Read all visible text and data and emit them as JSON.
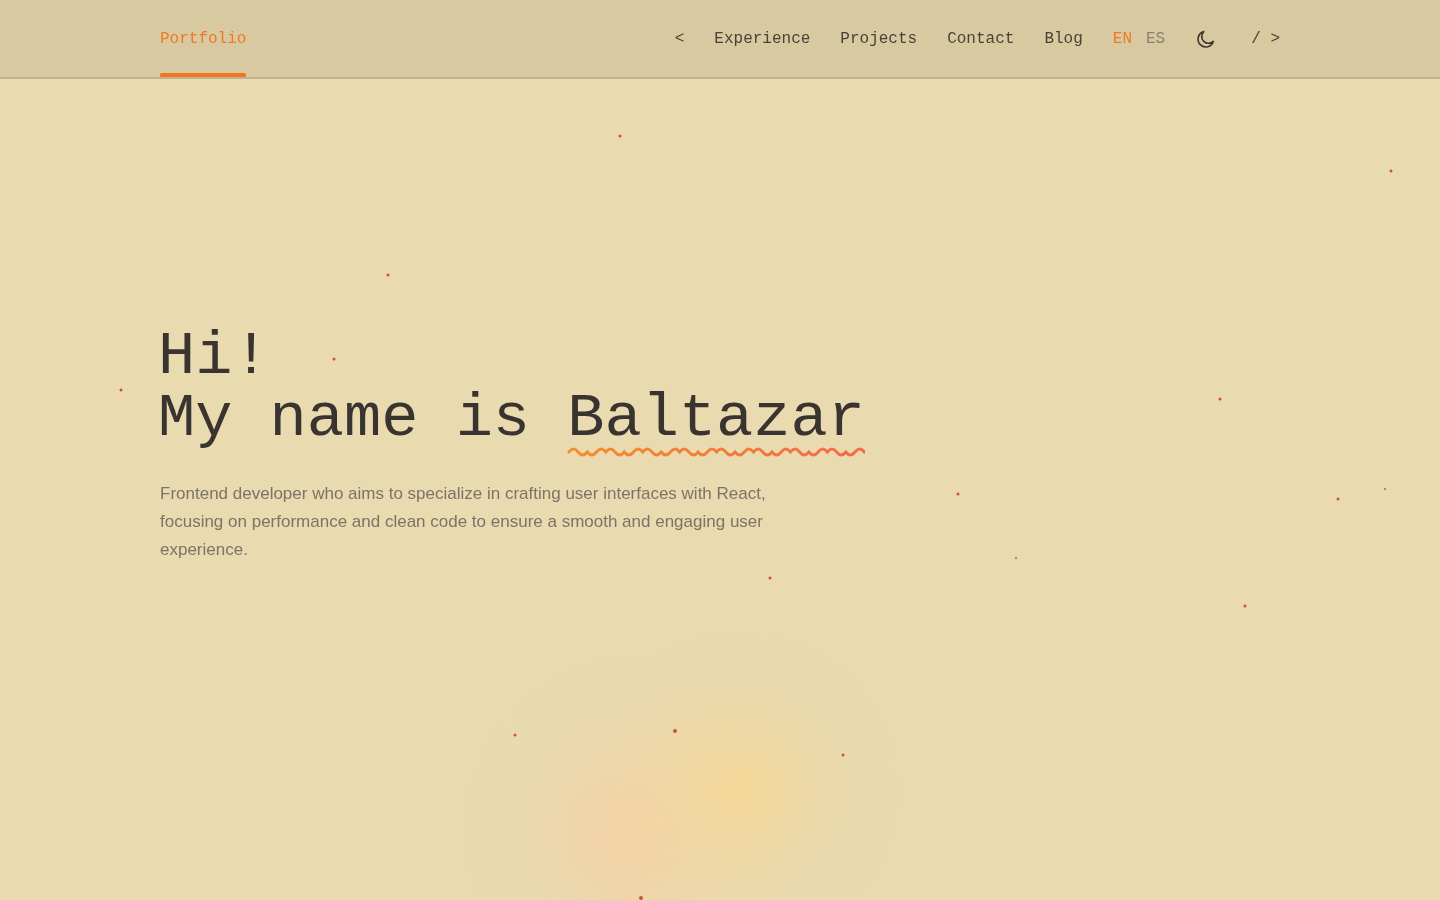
{
  "header": {
    "brand": {
      "label": "Portfolio",
      "selected": true
    },
    "open_bracket": "<",
    "nav_links": [
      {
        "label": "Experience",
        "selected": false
      },
      {
        "label": "Projects",
        "selected": false
      },
      {
        "label": "Contact",
        "selected": false
      },
      {
        "label": "Blog",
        "selected": false
      }
    ],
    "languages": [
      {
        "label": "EN",
        "selected": true
      },
      {
        "label": "ES",
        "selected": false
      }
    ],
    "close_bracket": "/ >"
  },
  "hero": {
    "greeting": "Hi!",
    "name_prefix": "My name is",
    "name": "Baltazar",
    "description": "Frontend developer who aims to specialize in crafting user interfaces with React, focusing on performance and clean code to ensure a smooth and engaging user experience."
  }
}
